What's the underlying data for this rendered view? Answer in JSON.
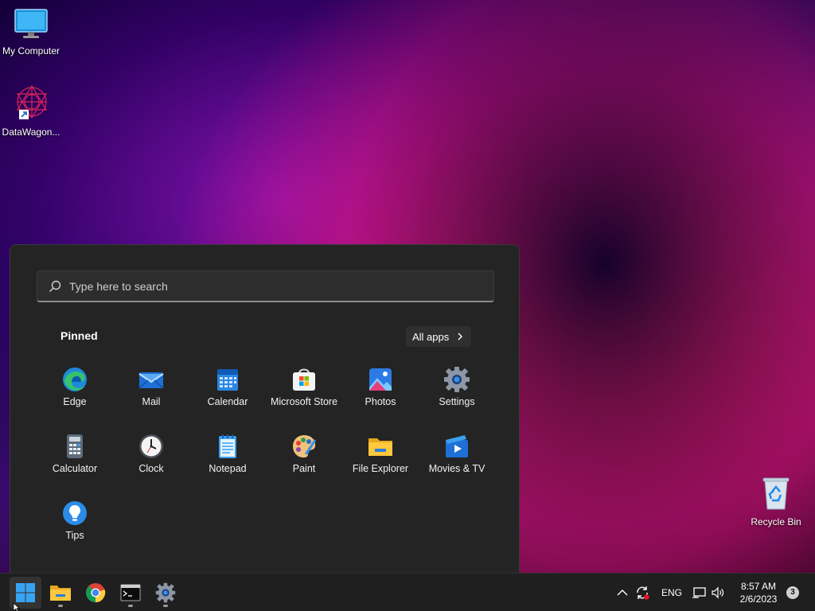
{
  "desktop": {
    "icons": [
      {
        "label": "My Computer",
        "icon": "monitor-icon"
      },
      {
        "label": "DataWagon...",
        "icon": "datawagon-shortcut-icon"
      },
      {
        "label": "Recycle Bin",
        "icon": "recycle-bin-icon"
      }
    ]
  },
  "start_menu": {
    "search": {
      "placeholder": "Type here to search",
      "value": ""
    },
    "pinned_label": "Pinned",
    "all_apps_label": "All apps",
    "pinned_apps": [
      {
        "label": "Edge",
        "icon": "edge-icon"
      },
      {
        "label": "Mail",
        "icon": "mail-icon"
      },
      {
        "label": "Calendar",
        "icon": "calendar-icon"
      },
      {
        "label": "Microsoft Store",
        "icon": "store-icon"
      },
      {
        "label": "Photos",
        "icon": "photos-icon"
      },
      {
        "label": "Settings",
        "icon": "settings-icon"
      },
      {
        "label": "Calculator",
        "icon": "calculator-icon"
      },
      {
        "label": "Clock",
        "icon": "clock-icon"
      },
      {
        "label": "Notepad",
        "icon": "notepad-icon"
      },
      {
        "label": "Paint",
        "icon": "paint-icon"
      },
      {
        "label": "File Explorer",
        "icon": "folder-icon"
      },
      {
        "label": "Movies & TV",
        "icon": "movies-icon"
      },
      {
        "label": "Tips",
        "icon": "tips-icon"
      }
    ]
  },
  "taskbar": {
    "apps": [
      {
        "name": "Start",
        "icon": "windows-start-icon"
      },
      {
        "name": "File Explorer",
        "icon": "folder-icon"
      },
      {
        "name": "Chrome",
        "icon": "chrome-icon"
      },
      {
        "name": "Terminal",
        "icon": "terminal-icon"
      },
      {
        "name": "Settings",
        "icon": "settings-icon"
      }
    ],
    "tray": {
      "language": "ENG",
      "time": "8:57 AM",
      "date": "2/6/2023",
      "notification_count": "3"
    }
  },
  "colors": {
    "accent": "#0078d4",
    "menu_bg": "#242424",
    "taskbar_bg": "#1f1f1f"
  }
}
